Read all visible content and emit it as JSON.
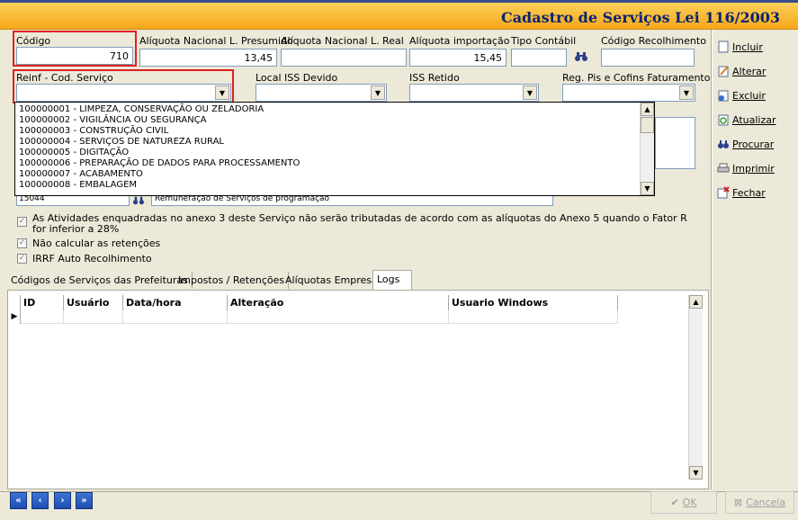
{
  "window": {
    "title": "Cadastro de Serviços Lei 116/2003"
  },
  "fields": {
    "codigo": {
      "label": "Código",
      "value": "710"
    },
    "aliq_presumido": {
      "label": "Alíquota Nacional L. Presumido",
      "value": "13,45"
    },
    "aliq_real": {
      "label": "Alíquota Nacional L. Real",
      "value": ""
    },
    "aliq_importacao": {
      "label": "Alíquota importação",
      "value": "15,45"
    },
    "tipo_contabil": {
      "label": "Tipo Contábil",
      "value": ""
    },
    "codigo_recolhimento": {
      "label": "Código Recolhimento",
      "value": ""
    },
    "reinf": {
      "label": "Reinf - Cod. Serviço",
      "value": ""
    },
    "local_iss": {
      "label": "Local ISS Devido",
      "value": ""
    },
    "iss_retido": {
      "label": "ISS Retido",
      "value": ""
    },
    "reg_pis": {
      "label": "Reg. Pis e Cofins Faturamento",
      "value": ""
    },
    "hidden_code": {
      "value": "15044"
    },
    "hidden_desc": {
      "value": "Remuneração de Serviços de programação"
    }
  },
  "dropdown_items": [
    "100000001 - LIMPEZA, CONSERVAÇÃO OU ZELADORIA",
    "100000002 - VIGILÂNCIA OU SEGURANÇA",
    "100000003 - CONSTRUÇÃO CIVIL",
    "100000004 - SERVIÇOS DE NATUREZA RURAL",
    "100000005 - DIGITAÇÃO",
    "100000006 - PREPARAÇÃO DE DADOS PARA PROCESSAMENTO",
    "100000007 - ACABAMENTO",
    "100000008 - EMBALAGEM"
  ],
  "checks": {
    "anexo3_line1": "As Atividades enquadradas no anexo 3 deste Serviço não serão tributadas de acordo com as alíquotas do Anexo 5 quando o Fator R",
    "anexo3_line2": "for inferior a 28%",
    "nao_calcular": "Não calcular as retenções",
    "irrf": "IRRF Auto Recolhimento"
  },
  "tabs": [
    "Códigos de Serviços das Prefeituras",
    "Impostos / Retenções",
    "Alíquotas Empresa",
    "Logs"
  ],
  "grid": {
    "columns": [
      "ID",
      "Usuário",
      "Data/hora",
      "Alteração",
      "Usuario Windows"
    ]
  },
  "sidebar": {
    "incluir": "Incluir",
    "alterar": "Alterar",
    "excluir": "Excluir",
    "atualizar": "Atualizar",
    "procurar": "Procurar",
    "imprimir": "Imprimir",
    "fechar": "Fechar"
  },
  "bottom": {
    "ok": "OK",
    "cancela": "Cancela"
  },
  "colors": {
    "header": "#f5a81a",
    "title": "#0a2470",
    "highlight": "#e02020"
  }
}
